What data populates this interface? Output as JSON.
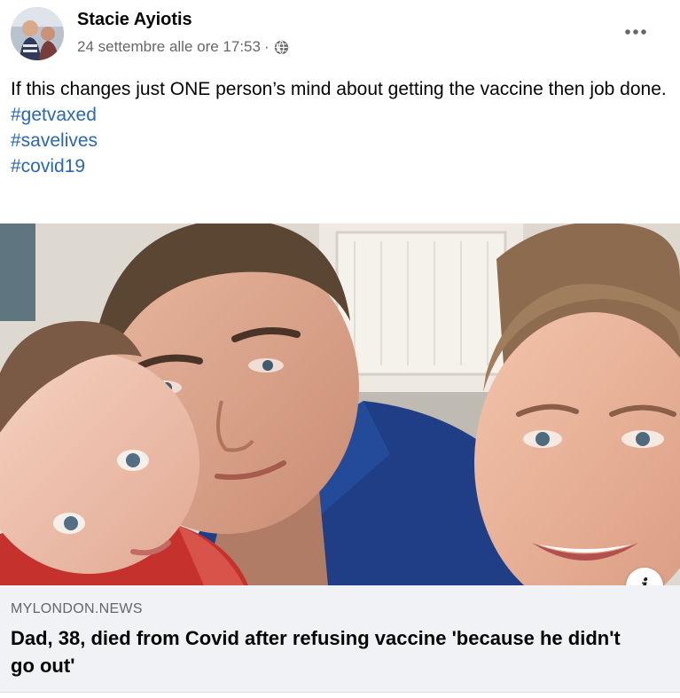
{
  "post": {
    "author": "Stacie Ayiotis",
    "timestamp": "24 settembre alle ore 17:53",
    "meta_separator": "·",
    "privacy_icon": "globe-icon",
    "more_icon": "more-options-icon",
    "text": "If this changes just ONE person’s mind about getting the vaccine then job done.",
    "hashtags": [
      "#getvaxed",
      "#savelives",
      "#covid19"
    ]
  },
  "link_preview": {
    "domain": "MYLONDON.NEWS",
    "headline": "Dad, 38, died from Covid after refusing vaccine 'because he didn't go out'",
    "info_icon": "info-icon",
    "info_glyph": "i"
  },
  "colors": {
    "hashtag": "#2a67b1",
    "meta_text": "#65676b",
    "card_background": "#f0f2f5"
  }
}
